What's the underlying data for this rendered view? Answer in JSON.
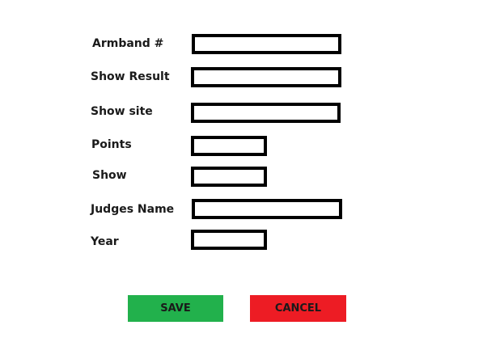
{
  "form": {
    "fields": [
      {
        "label": "Armband #",
        "value": "",
        "placeholder": ""
      },
      {
        "label": "Show Result",
        "value": "",
        "placeholder": ""
      },
      {
        "label": "Show site",
        "value": "",
        "placeholder": ""
      },
      {
        "label": "Points",
        "value": "",
        "placeholder": ""
      },
      {
        "label": "Show",
        "value": "",
        "placeholder": ""
      },
      {
        "label": "Judges Name",
        "value": "",
        "placeholder": ""
      },
      {
        "label": "Year",
        "value": "",
        "placeholder": ""
      }
    ]
  },
  "actions": {
    "save_label": "SAVE",
    "cancel_label": "CANCEL"
  },
  "colors": {
    "save_bg": "#22b14c",
    "cancel_bg": "#ed1c24",
    "field_border": "#000000"
  }
}
